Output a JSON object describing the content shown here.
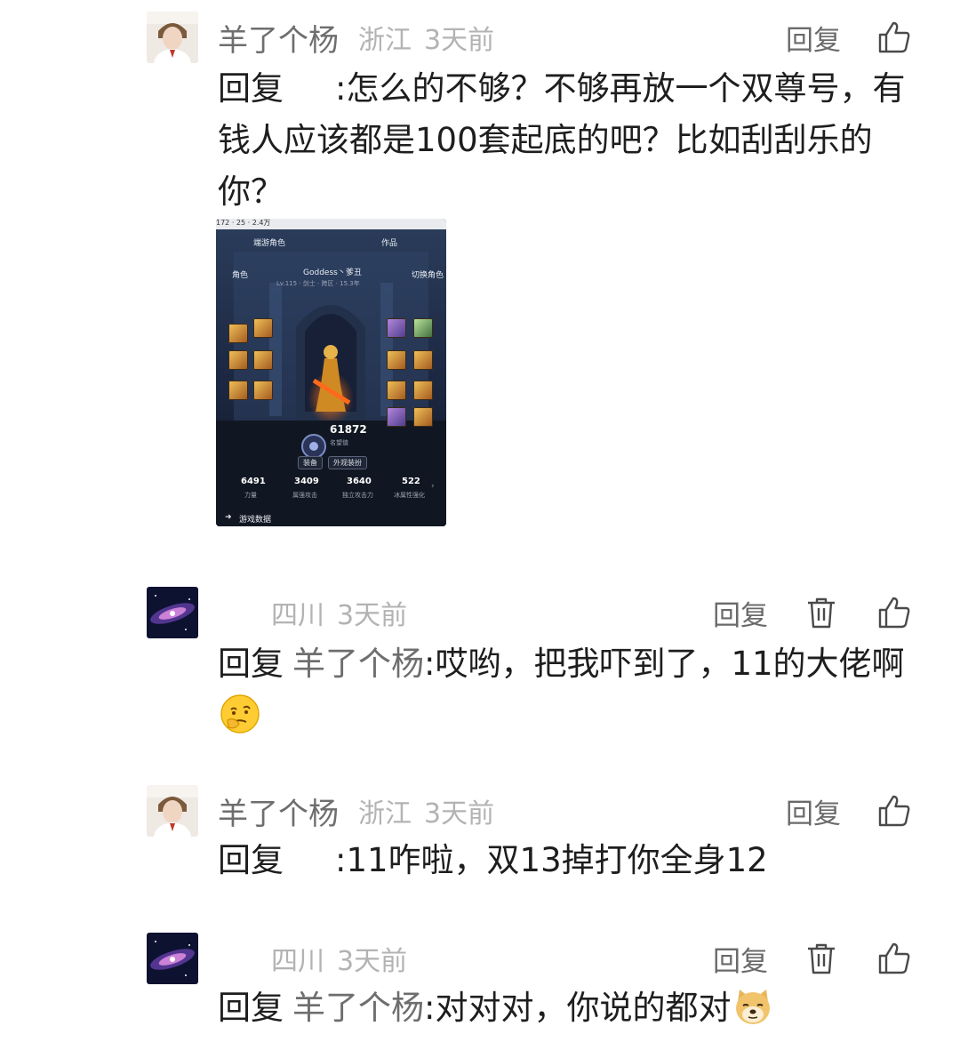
{
  "colors": {
    "name": "#6e6e6e",
    "meta": "#b3b3b3",
    "text": "#1e1e1e"
  },
  "comments": [
    {
      "name": "羊了个杨",
      "location": "浙江",
      "time": "3天前",
      "reply_btn": "回复",
      "reply_prefix": "回复",
      "reply_target": "",
      "text": ":怎么的不够？不够再放一个双尊号，有钱人应该都是100套起底的吧？比如刮刮乐的你？",
      "icons": [
        "thumbs-up-icon"
      ]
    },
    {
      "name": "",
      "location": "四川",
      "time": "3天前",
      "reply_btn": "回复",
      "reply_prefix": "回复",
      "reply_target": "羊了个杨",
      "text": ":哎哟，把我吓到了，11的大佬啊",
      "emoji": "thinking-face-emoji",
      "icons": [
        "trash-icon",
        "thumbs-up-icon"
      ]
    },
    {
      "name": "羊了个杨",
      "location": "浙江",
      "time": "3天前",
      "reply_btn": "回复",
      "reply_prefix": "回复",
      "reply_target": "",
      "text": ":11咋啦，双13掉打你全身12",
      "icons": [
        "thumbs-up-icon"
      ]
    },
    {
      "name": "",
      "location": "四川",
      "time": "3天前",
      "reply_btn": "回复",
      "reply_prefix": "回复",
      "reply_target": "羊了个杨",
      "text": ":对对对，你说的都对",
      "emoji": "doge-emoji",
      "icons": [
        "trash-icon",
        "thumbs-up-icon"
      ]
    }
  ],
  "screenshot": {
    "top_strip": "172 ·  25  ·  2.4万",
    "header_left": "端游角色",
    "header_right": "作品",
    "btn_left": "角色",
    "btn_right": "切换角色",
    "char_name": "Goddess丶爹丑",
    "char_sub": "Lv.115 · 剑士 · 跨区 · 15.3年",
    "score": "61872",
    "score_label": "名望值",
    "tab_equip": "装备",
    "tab_appearance": "外观装扮",
    "stats": [
      {
        "value": "6491",
        "label": "力量"
      },
      {
        "value": "3409",
        "label": "属强攻击"
      },
      {
        "value": "3640",
        "label": "独立攻击力"
      },
      {
        "value": "522",
        "label": "冰属性强化"
      }
    ],
    "footer": "游戏数据"
  }
}
